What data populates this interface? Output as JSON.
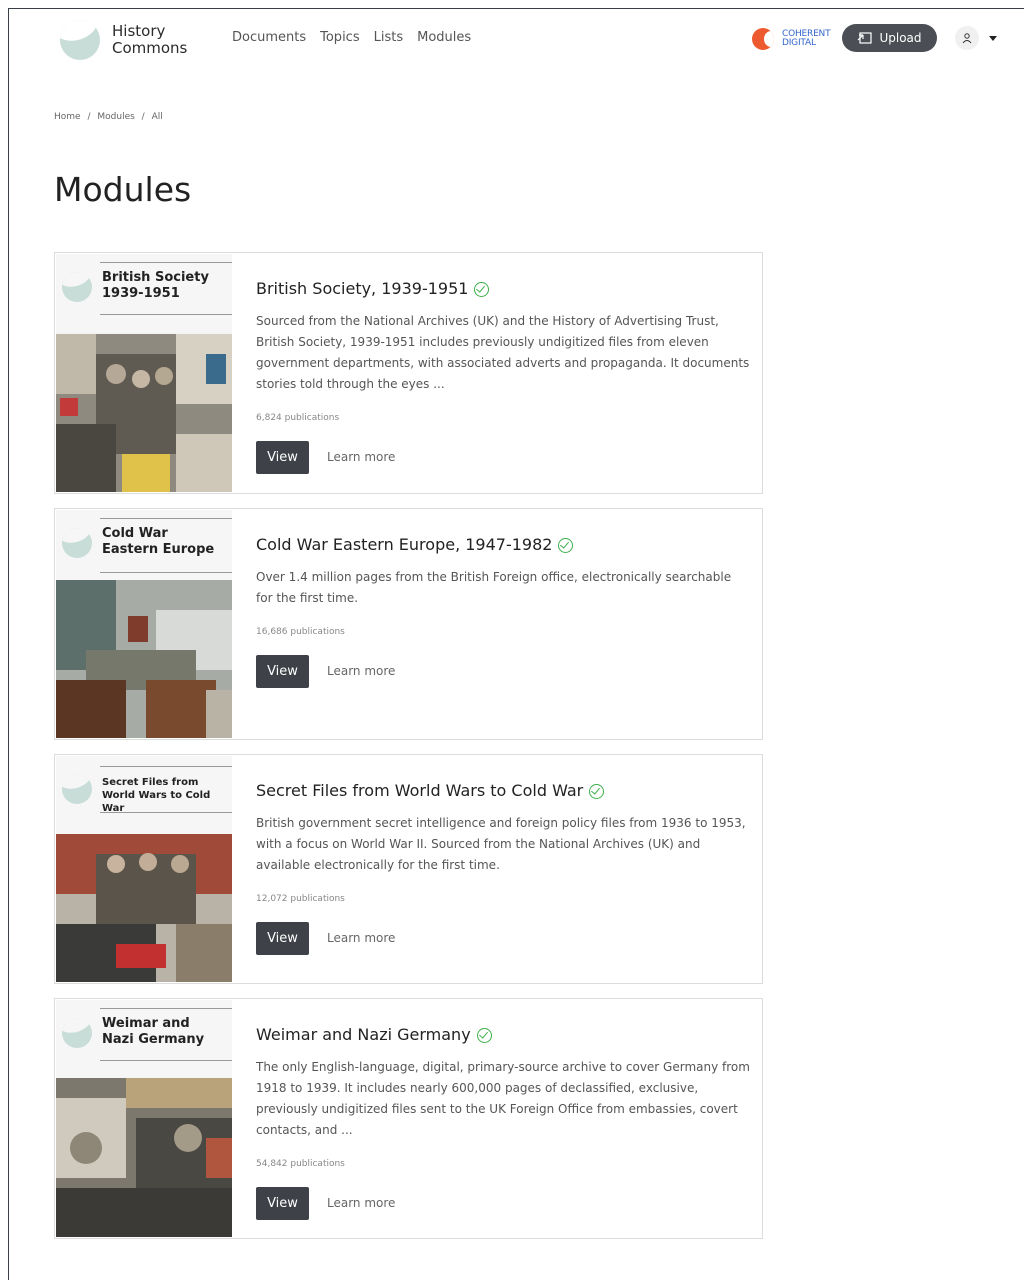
{
  "header": {
    "brand_line1": "History",
    "brand_line2": "Commons",
    "nav": [
      "Documents",
      "Topics",
      "Lists",
      "Modules"
    ],
    "partner_line1": "COHERENT",
    "partner_line2": "DIGITAL",
    "upload_label": "Upload",
    "user_icon": "user-icon"
  },
  "breadcrumb": [
    "Home",
    "/",
    "Modules",
    "/",
    "All"
  ],
  "page_title": "Modules",
  "modules": [
    {
      "cover_line1": "British Society",
      "cover_line2": "1939-1951",
      "title": "British Society, 1939-1951",
      "description": "Sourced from the National Archives (UK) and the History of Advertising Trust, British Society, 1939-1951 includes previously undigitized files from eleven government departments, with associated adverts and propaganda. It documents stories told through the eyes ...",
      "publications": "6,824 publications",
      "view_label": "View",
      "learn_label": "Learn more"
    },
    {
      "cover_line1": "Cold War",
      "cover_line2": "Eastern Europe",
      "title": "Cold War Eastern Europe, 1947-1982",
      "description": "Over 1.4 million pages from the British Foreign office, electronically searchable for the first time.",
      "publications": "16,686 publications",
      "view_label": "View",
      "learn_label": "Learn more"
    },
    {
      "cover_line1": "Secret Files from",
      "cover_line2": "World Wars to Cold War",
      "title": "Secret Files from World Wars to Cold War",
      "description": "British government secret intelligence and foreign policy files from 1936 to 1953, with a focus on World War II. Sourced from the National Archives (UK) and available electronically for the first time.",
      "publications": "12,072 publications",
      "view_label": "View",
      "learn_label": "Learn more"
    },
    {
      "cover_line1": "Weimar and",
      "cover_line2": "Nazi Germany",
      "title": "Weimar and Nazi Germany",
      "description": "The only English-language, digital, primary-source archive to cover Germany from 1918 to 1939. It includes nearly 600,000 pages of declassified, exclusive, previously undigitized files sent to the UK Foreign Office from embassies, covert contacts, and ...",
      "publications": "54,842 publications",
      "view_label": "View",
      "learn_label": "Learn more"
    }
  ],
  "colors": {
    "button_dark": "#3e4147",
    "verified_green": "#3cb04a",
    "partner_orange": "#ee5a2f",
    "partner_blue": "#3366cc"
  }
}
